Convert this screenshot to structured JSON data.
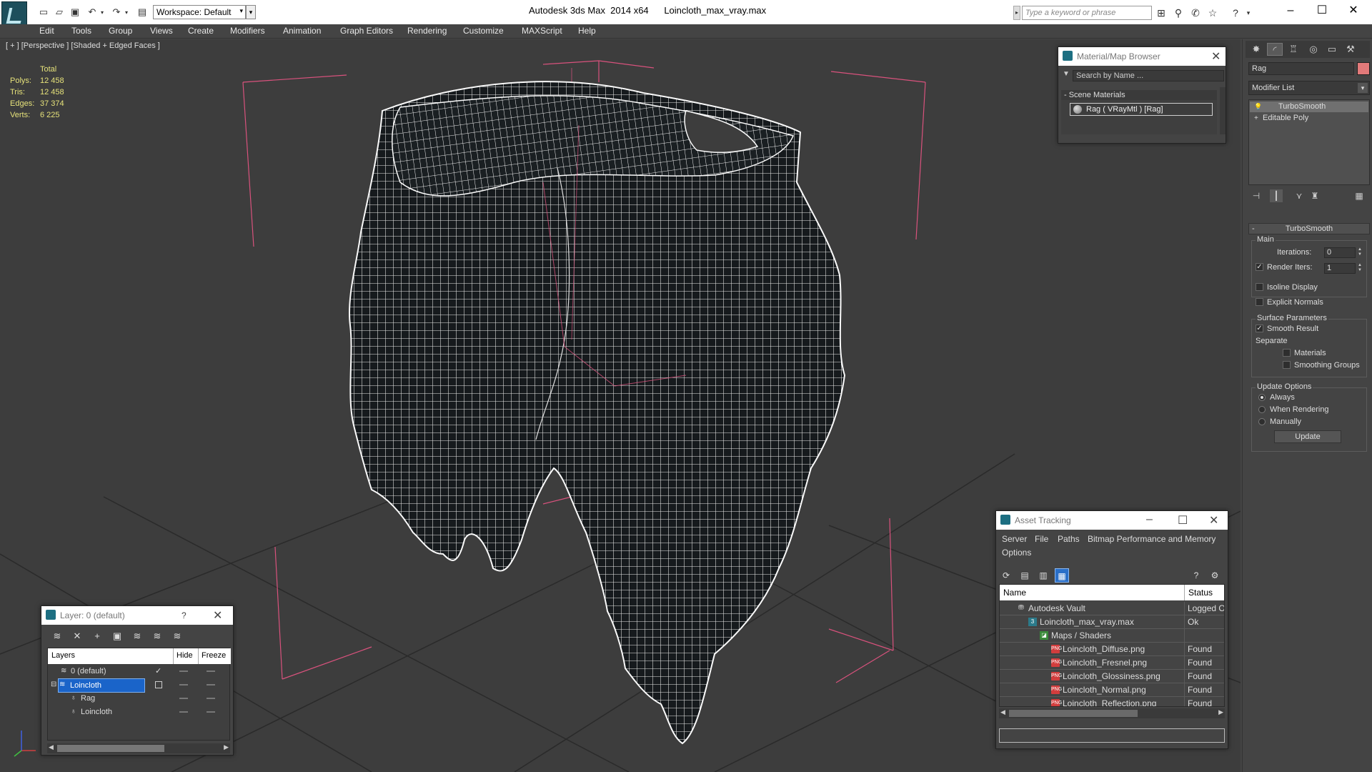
{
  "app": {
    "title": "Autodesk 3ds Max  2014 x64      Loincloth_max_vray.max",
    "workspace": "Workspace: Default",
    "search_placeholder": "Type a keyword or phrase"
  },
  "menu": [
    "Edit",
    "Tools",
    "Group",
    "Views",
    "Create",
    "Modifiers",
    "Animation",
    "Graph Editors",
    "Rendering",
    "Customize",
    "MAXScript",
    "Help"
  ],
  "viewport": {
    "label": "[ + ] [Perspective ] [Shaded + Edged Faces ]",
    "stats": {
      "header": "Total",
      "rows": [
        {
          "label": "Polys:",
          "value": "12 458"
        },
        {
          "label": "Tris:",
          "value": "12 458"
        },
        {
          "label": "Edges:",
          "value": "37 374"
        },
        {
          "label": "Verts:",
          "value": "6 225"
        }
      ]
    }
  },
  "material_browser": {
    "title": "Material/Map Browser",
    "search_placeholder": "Search by Name ...",
    "section": "- Scene Materials",
    "item": "Rag  ( VRayMtl ) [Rag]"
  },
  "command_panel": {
    "object_name": "Rag",
    "object_color": "#e37a7a",
    "modifier_list": "Modifier List",
    "stack": [
      "TurboSmooth",
      "Editable Poly"
    ],
    "turbosmooth": {
      "header": "TurboSmooth",
      "main_group": "Main",
      "iterations_label": "Iterations:",
      "iterations_value": "0",
      "render_iters_label": "Render Iters:",
      "render_iters_value": "1",
      "render_iters_checked": "✓",
      "isoline_label": "Isoline Display",
      "explicit_normals_label": "Explicit Normals",
      "surface_group": "Surface Parameters",
      "smooth_result_label": "Smooth Result",
      "smooth_result_checked": "✓",
      "separate_label": "Separate",
      "materials_label": "Materials",
      "smoothing_groups_label": "Smoothing Groups",
      "update_group": "Update Options",
      "update_always": "Always",
      "update_when_rendering": "When Rendering",
      "update_manually": "Manually",
      "update_button": "Update"
    }
  },
  "asset_tracking": {
    "title": "Asset Tracking",
    "menu": [
      "Server",
      "File",
      "Paths",
      "Bitmap Performance and Memory",
      "Options"
    ],
    "columns": [
      "Name",
      "Status"
    ],
    "rows": [
      {
        "name": "Autodesk Vault",
        "status": "Logged Ou"
      },
      {
        "name": "Loincloth_max_vray.max",
        "status": "Ok"
      },
      {
        "name": "Maps / Shaders",
        "status": ""
      },
      {
        "name": "Loincloth_Diffuse.png",
        "status": "Found"
      },
      {
        "name": "Loincloth_Fresnel.png",
        "status": "Found"
      },
      {
        "name": "Loincloth_Glossiness.png",
        "status": "Found"
      },
      {
        "name": "Loincloth_Normal.png",
        "status": "Found"
      },
      {
        "name": "Loincloth_Reflection.png",
        "status": "Found"
      }
    ]
  },
  "layer_dialog": {
    "title": "Layer: 0 (default)",
    "help": "?",
    "columns": [
      "Layers",
      "Hide",
      "Freeze"
    ],
    "rows": [
      {
        "name": "0 (default)"
      },
      {
        "name": "Loincloth"
      },
      {
        "name": "Rag"
      },
      {
        "name": "Loincloth"
      }
    ],
    "default_check": "✓"
  },
  "icons": {
    "png": "PNG"
  }
}
